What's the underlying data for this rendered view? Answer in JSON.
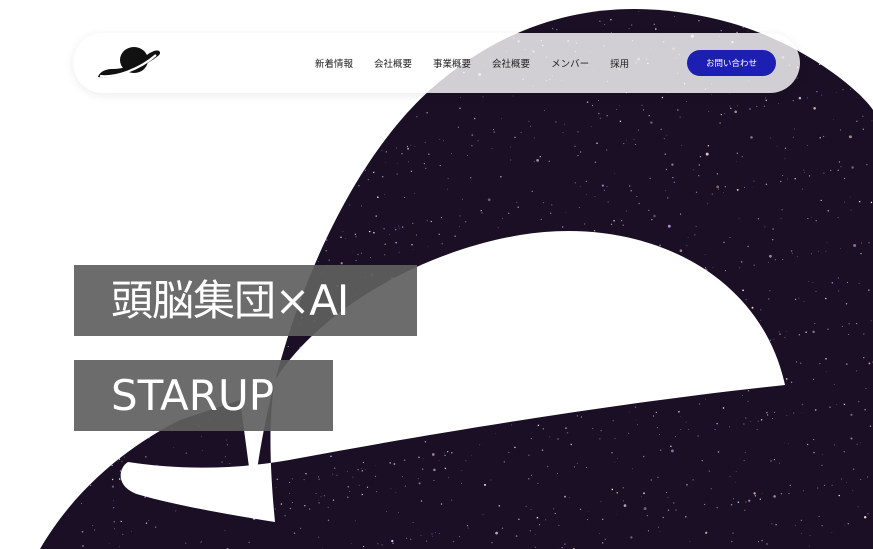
{
  "brand": {
    "logo_icon": "planet-logo-icon",
    "accent_color": "#1d1fb3",
    "space_color": "#1a0f24"
  },
  "nav": {
    "items": [
      {
        "label": "新着情報",
        "name": "nav-item-news"
      },
      {
        "label": "会社概要",
        "name": "nav-item-company"
      },
      {
        "label": "事業概要",
        "name": "nav-item-business"
      },
      {
        "label": "会社概要",
        "name": "nav-item-company-2"
      },
      {
        "label": "メンバー",
        "name": "nav-item-members"
      },
      {
        "label": "採用",
        "name": "nav-item-recruit"
      }
    ],
    "contact_label": "お問い合わせ"
  },
  "hero": {
    "headline_1": "頭脳集団×AI",
    "headline_2": "STARUP"
  }
}
